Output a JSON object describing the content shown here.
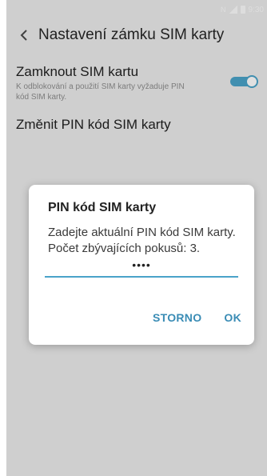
{
  "status_bar": {
    "time": "9:30",
    "icons": [
      "nfc-icon",
      "signal-icon",
      "battery-icon"
    ]
  },
  "app_bar": {
    "title": "Nastavení zámku SIM karty"
  },
  "settings": [
    {
      "title": "Zamknout SIM kartu",
      "subtitle": "K odblokování a použití SIM karty vyžaduje PIN kód SIM karty.",
      "toggle_on": true
    },
    {
      "title": "Změnit PIN kód SIM karty"
    }
  ],
  "dialog": {
    "title": "PIN kód SIM karty",
    "message_line1": "Zadejte aktuální PIN kód SIM karty.",
    "message_line2": "Počet zbývajících pokusů: 3.",
    "pin_value": "••••",
    "cancel_label": "STORNO",
    "ok_label": "OK"
  },
  "colors": {
    "accent": "#4aa3c9",
    "button_text": "#3a8cb5"
  }
}
